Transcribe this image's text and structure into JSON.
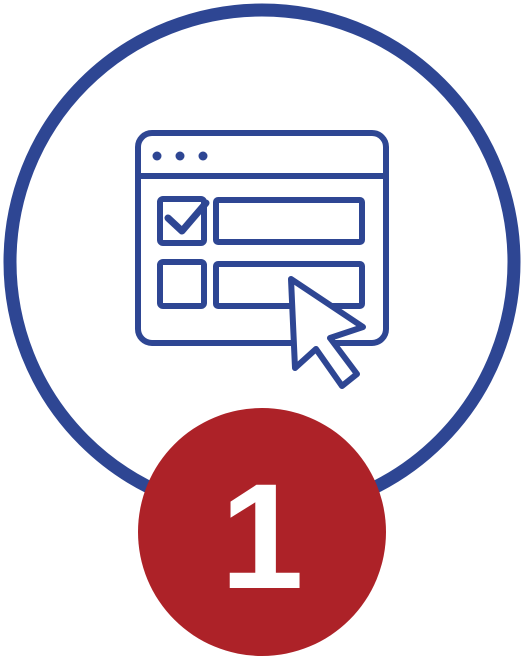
{
  "icon": {
    "name": "web-form-selection-icon",
    "ring_color": "#2e4693",
    "line_color": "#2e4693",
    "background_color": "#ffffff"
  },
  "badge": {
    "number": "1",
    "fill_color": "#ad2228",
    "text_color": "#ffffff"
  }
}
